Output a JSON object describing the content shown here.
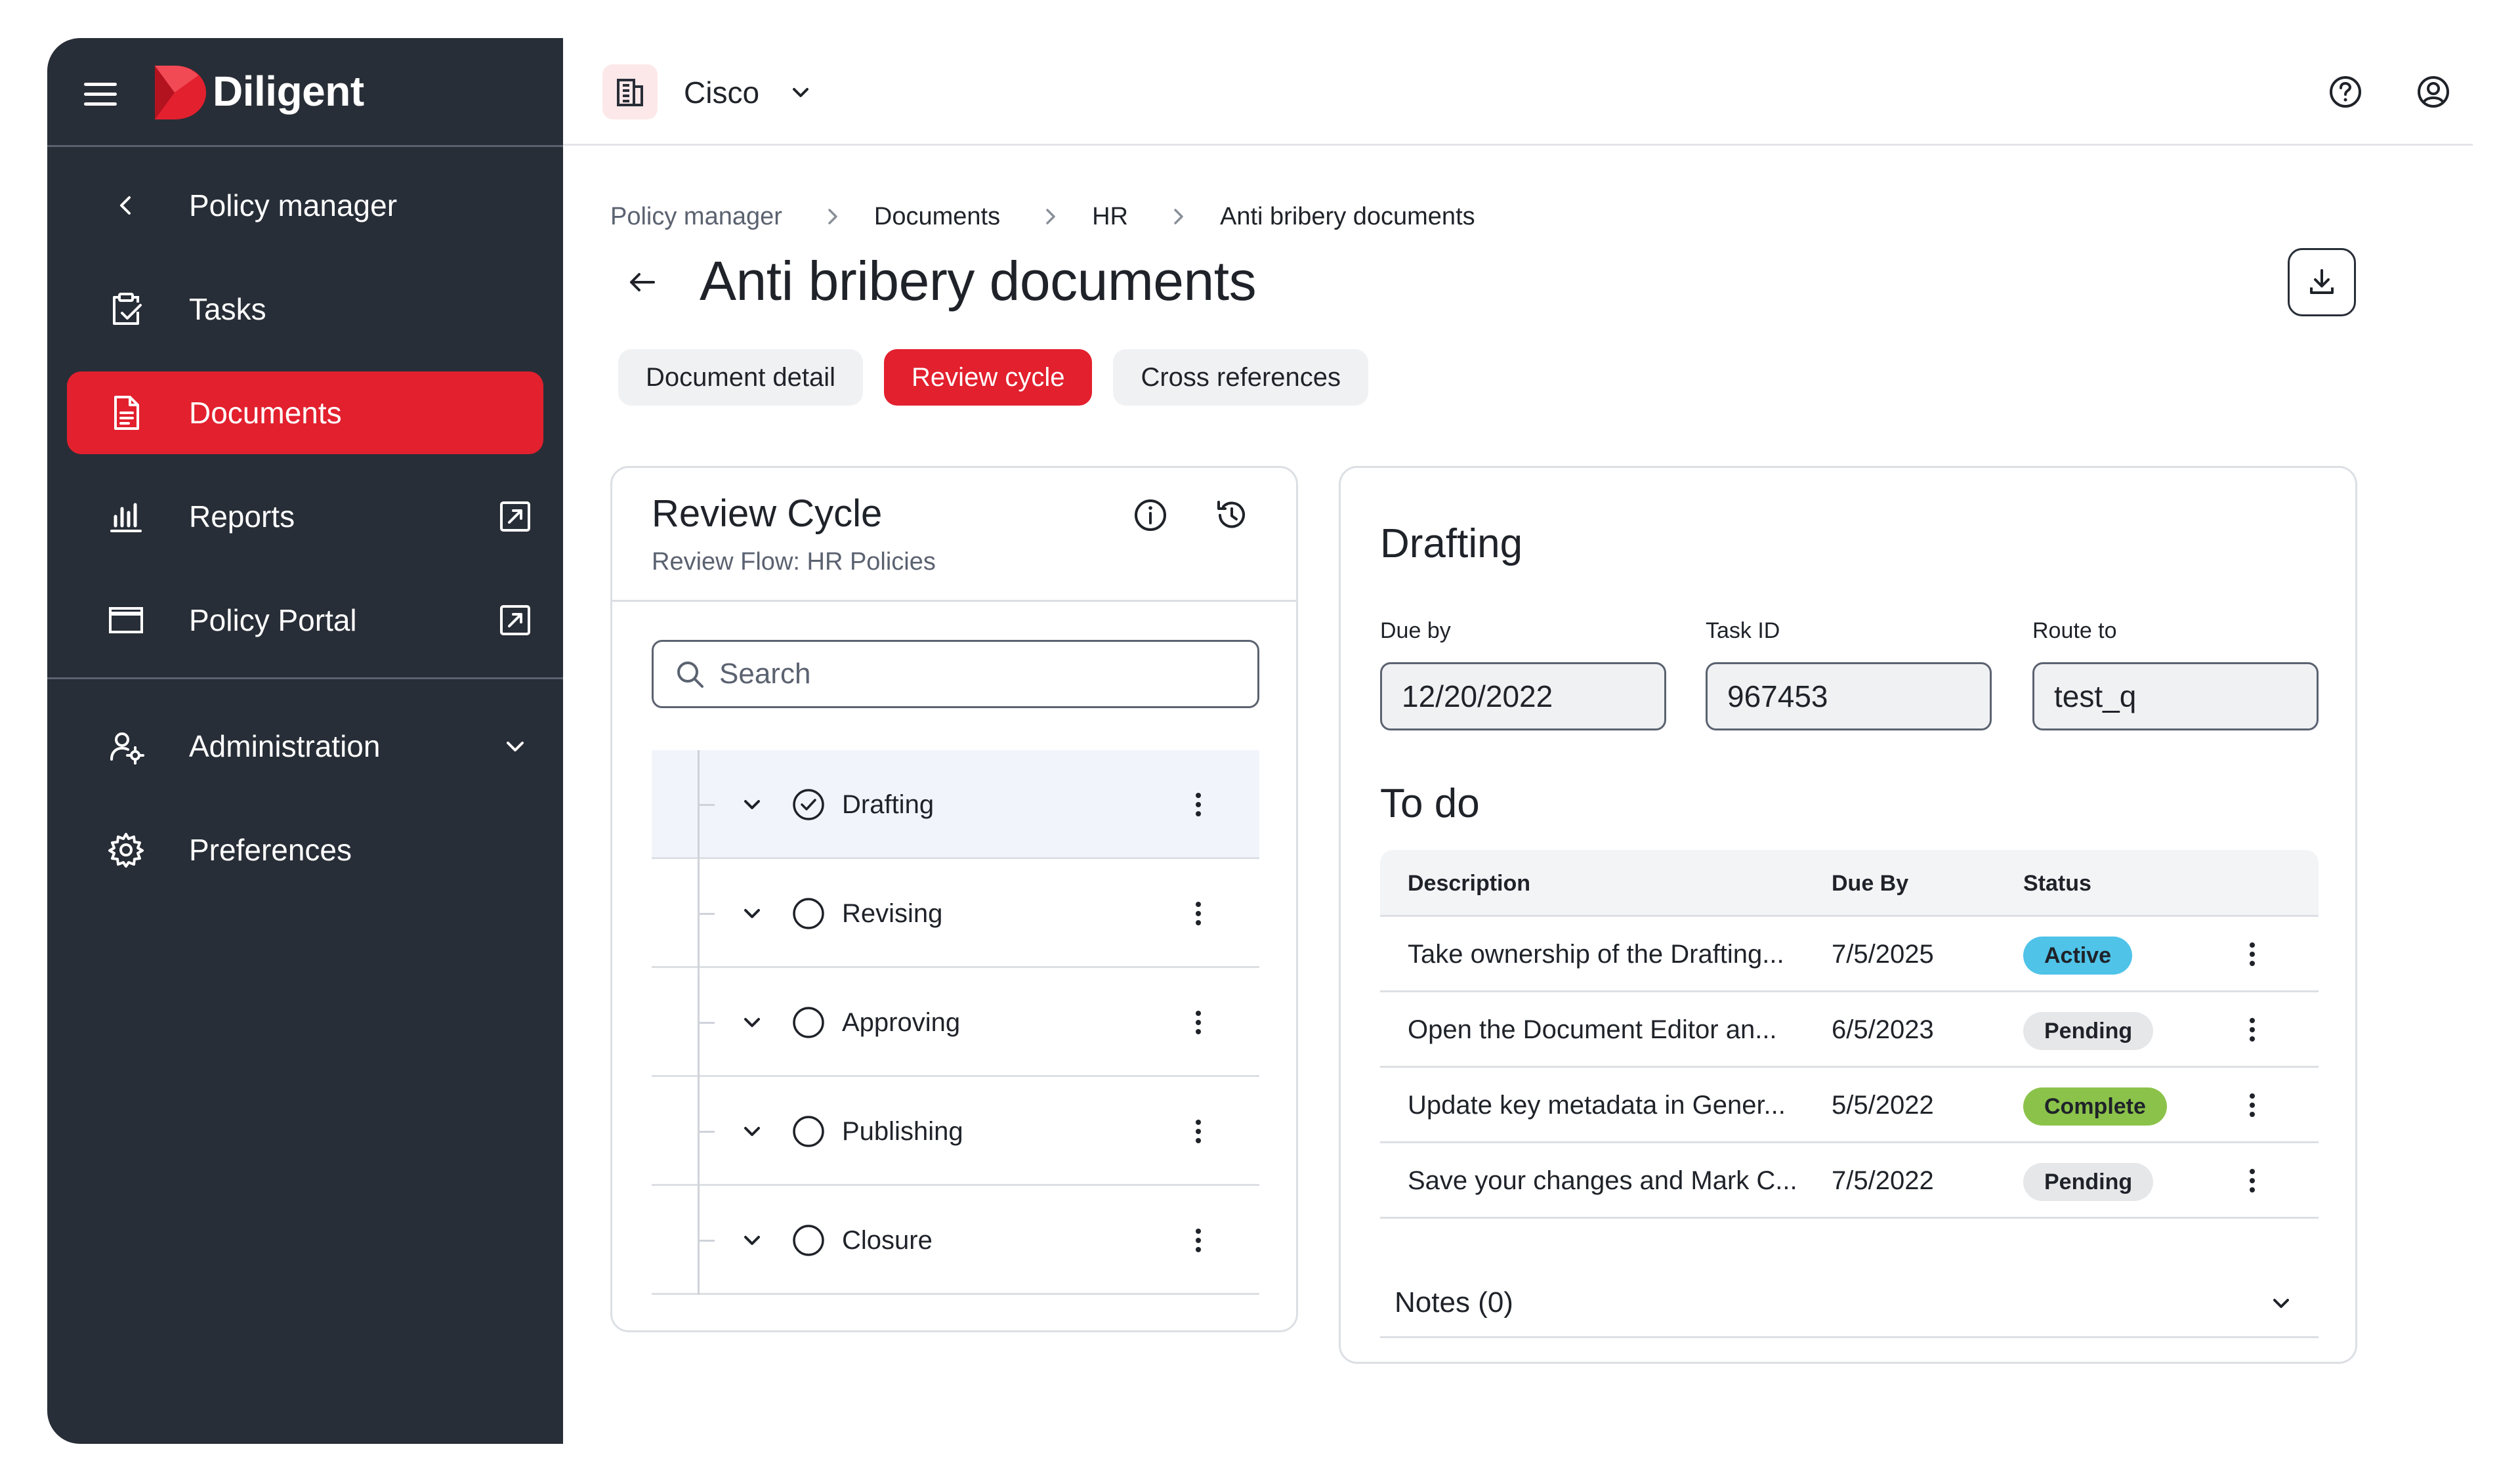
{
  "brand": {
    "name": "Diligent",
    "accent": "#e3202e",
    "sidebar_bg": "#282e37"
  },
  "sidebar": {
    "items": [
      {
        "label": "Policy manager",
        "icon": "chevron-left-icon"
      },
      {
        "label": "Tasks",
        "icon": "clipboard-check-icon"
      },
      {
        "label": "Documents",
        "icon": "document-icon",
        "active": true
      },
      {
        "label": "Reports",
        "icon": "bar-chart-icon",
        "external": true
      },
      {
        "label": "Policy Portal",
        "icon": "window-icon",
        "external": true
      },
      {
        "label": "Administration",
        "icon": "user-settings-icon",
        "expandable": true
      },
      {
        "label": "Preferences",
        "icon": "gear-icon"
      }
    ]
  },
  "topbar": {
    "org_name": "Cisco",
    "org_icon": "building-icon"
  },
  "breadcrumb": [
    "Policy manager",
    "Documents",
    "HR",
    "Anti bribery documents"
  ],
  "page": {
    "title": "Anti bribery documents"
  },
  "tabs": [
    {
      "label": "Document detail",
      "active": false
    },
    {
      "label": "Review cycle",
      "active": true
    },
    {
      "label": "Cross references",
      "active": false
    }
  ],
  "review_cycle": {
    "title": "Review Cycle",
    "subtitle": "Review Flow: HR Policies",
    "search_placeholder": "Search",
    "stages": [
      {
        "label": "Drafting",
        "done": true,
        "selected": true
      },
      {
        "label": "Revising",
        "done": false
      },
      {
        "label": "Approving",
        "done": false
      },
      {
        "label": "Publishing",
        "done": false
      },
      {
        "label": "Closure",
        "done": false
      }
    ]
  },
  "drafting": {
    "title": "Drafting",
    "due_by": {
      "label": "Due by",
      "value": "12/20/2022"
    },
    "task_id": {
      "label": "Task ID",
      "value": "967453"
    },
    "route_to": {
      "label": "Route to",
      "value": "test_q"
    },
    "todo": {
      "title": "To do",
      "columns": [
        "Description",
        "Due By",
        "Status"
      ],
      "rows": [
        {
          "description": "Take ownership of the Drafting...",
          "due": "7/5/2025",
          "status": "Active",
          "color": "#4fc3e8"
        },
        {
          "description": "Open the Document Editor an...",
          "due": "6/5/2023",
          "status": "Pending",
          "color": "#e6e7e9"
        },
        {
          "description": "Update key metadata in Gener...",
          "due": "5/5/2022",
          "status": "Complete",
          "color": "#8bc34a"
        },
        {
          "description": "Save your changes and Mark C...",
          "due": "7/5/2022",
          "status": "Pending",
          "color": "#e6e7e9"
        }
      ]
    },
    "notes": {
      "label": "Notes (0)"
    }
  }
}
